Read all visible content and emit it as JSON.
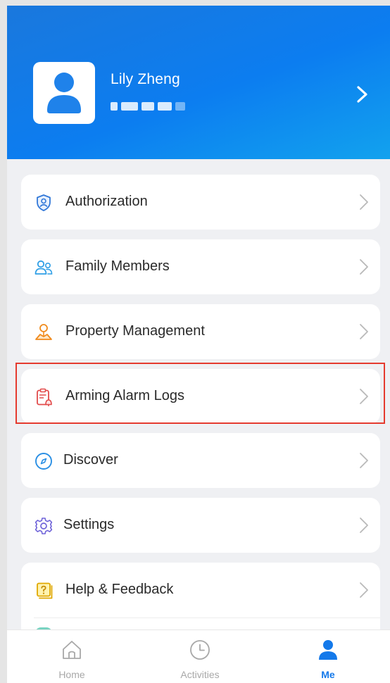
{
  "profile": {
    "name": "Lily Zheng"
  },
  "menu": {
    "items": [
      {
        "label": "Authorization",
        "icon": "shield-person-icon"
      },
      {
        "label": "Family Members",
        "icon": "family-icon"
      },
      {
        "label": "Property Management",
        "icon": "property-icon"
      },
      {
        "label": "Arming Alarm Logs",
        "icon": "alarm-log-icon"
      },
      {
        "label": "Discover",
        "icon": "compass-icon"
      },
      {
        "label": "Settings",
        "icon": "gear-icon"
      },
      {
        "label": "Help & Feedback",
        "icon": "help-icon"
      }
    ]
  },
  "tabbar": {
    "tabs": [
      {
        "label": "Home",
        "icon": "home-icon",
        "active": false
      },
      {
        "label": "Activities",
        "icon": "clock-icon",
        "active": false
      },
      {
        "label": "Me",
        "icon": "person-icon",
        "active": true
      }
    ]
  },
  "colors": {
    "header_blue": "#0c7df0",
    "accent": "#1479ea",
    "highlight_border": "#e53b2f"
  }
}
